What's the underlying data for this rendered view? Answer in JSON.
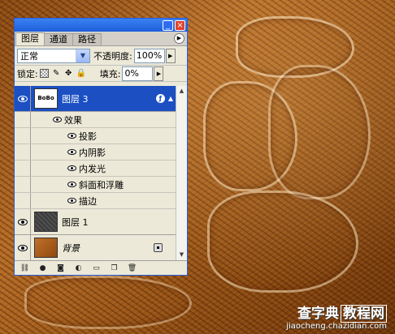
{
  "tabs": [
    {
      "label": "图层",
      "active": true
    },
    {
      "label": "通道",
      "active": false
    },
    {
      "label": "路径",
      "active": false
    }
  ],
  "blend_mode": "正常",
  "opacity_label": "不透明度:",
  "opacity_value": "100%",
  "lock_label": "锁定:",
  "fill_label": "填充:",
  "fill_value": "0%",
  "layers": {
    "layer3": {
      "name": "图层 3",
      "thumb_text": "BoBo",
      "selected": true
    },
    "effects_header": "效果",
    "effects": [
      "投影",
      "内阴影",
      "内发光",
      "斜面和浮雕",
      "描边"
    ],
    "layer1": {
      "name": "图层 1"
    },
    "background": {
      "name": "背景",
      "locked": true
    }
  },
  "icons": {
    "window": [
      "minimize-icon",
      "close-icon"
    ],
    "locks": [
      "lock-transparency-icon",
      "lock-paint-icon",
      "lock-move-icon",
      "lock-all-icon"
    ],
    "bottom": [
      "link-icon",
      "add-style-icon",
      "add-mask-icon",
      "adjustment-layer-icon",
      "new-group-icon",
      "new-layer-icon",
      "trash-icon"
    ]
  },
  "watermark": {
    "main_left": "查字典",
    "main_right": "教程网",
    "url": "jiaocheng.chazidian.com"
  },
  "colors": {
    "selected_layer": "#1b4fc2",
    "panel_bg": "#ece9d8",
    "titlebar": "#2a6fe6"
  }
}
